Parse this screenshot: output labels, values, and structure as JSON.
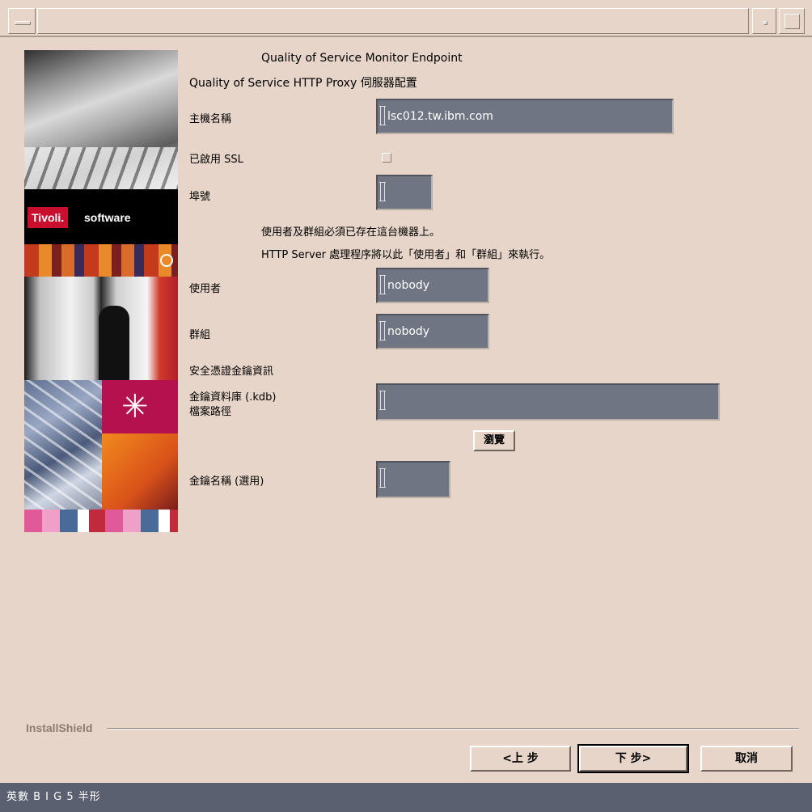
{
  "window": {
    "title": ""
  },
  "header": {
    "product": "Quality of Service Monitor Endpoint",
    "subtitle": "Quality of Service HTTP Proxy 伺服器配置"
  },
  "side_image": {
    "brand": "Tivoli.",
    "brand_suffix": "software"
  },
  "form": {
    "hostname": {
      "label": "主機名稱",
      "value": "lsc012.tw.ibm.com"
    },
    "ssl": {
      "label": "已啟用 SSL",
      "checked": false
    },
    "port": {
      "label": "埠號",
      "value": ""
    },
    "note_1": "使用者及群組必須已存在這台機器上。",
    "note_2": "HTTP Server 處理程序將以此「使用者」和「群組」來執行。",
    "user": {
      "label": "使用者",
      "value": "nobody"
    },
    "group": {
      "label": "群組",
      "value": "nobody"
    },
    "security_heading": "安全憑證金鑰資訊",
    "kdb_path": {
      "label_line1": "金鑰資料庫 (.kdb)",
      "label_line2": "檔案路徑",
      "value": ""
    },
    "browse_label": "瀏覽",
    "key_name": {
      "label": "金鑰名稱 (選用)",
      "value": ""
    }
  },
  "footer": {
    "installshield": "InstallShield",
    "back_label": "<上 步",
    "next_label": "下 步>",
    "cancel_label": "取消"
  },
  "statusbar": {
    "text": "英數  B I G 5  半形"
  }
}
